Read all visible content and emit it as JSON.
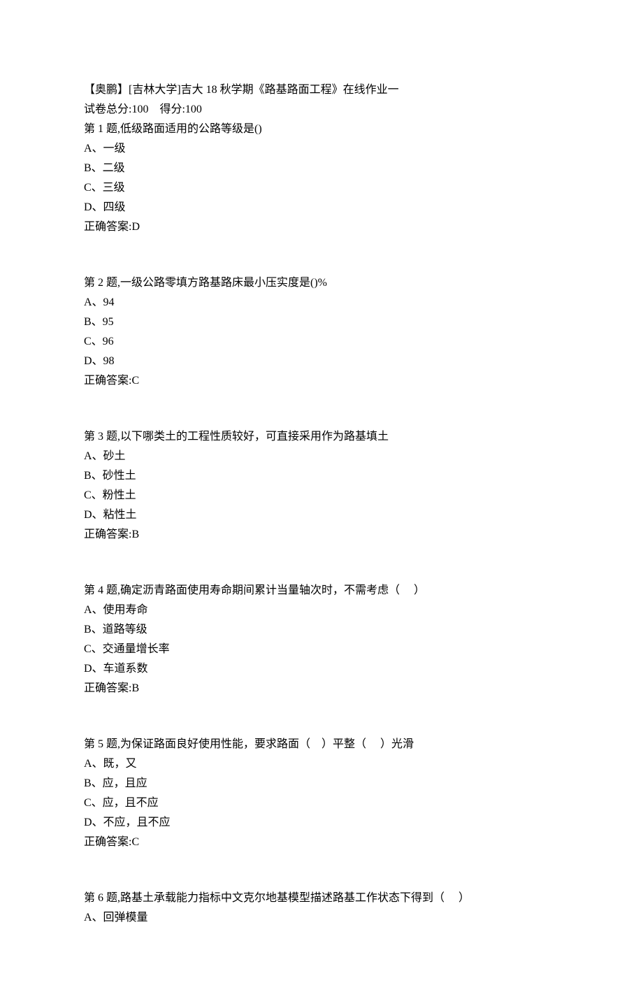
{
  "header": {
    "title": "【奥鹏】[吉林大学]吉大 18 秋学期《路基路面工程》在线作业一",
    "scoreline": "试卷总分:100    得分:100"
  },
  "questions": [
    {
      "stem": "第 1 题,低级路面适用的公路等级是()",
      "options": [
        "A、一级",
        "B、二级",
        "C、三级",
        "D、四级"
      ],
      "answer": "正确答案:D"
    },
    {
      "stem": "第 2 题,一级公路零填方路基路床最小压实度是()%",
      "options": [
        "A、94",
        "B、95",
        "C、96",
        "D、98"
      ],
      "answer": "正确答案:C"
    },
    {
      "stem": "第 3 题,以下哪类土的工程性质较好，可直接采用作为路基填土",
      "options": [
        "A、砂土",
        "B、砂性土",
        "C、粉性土",
        "D、粘性土"
      ],
      "answer": "正确答案:B"
    },
    {
      "stem": "第 4 题,确定沥青路面使用寿命期间累计当量轴次时，不需考虑（     ）",
      "options": [
        "A、使用寿命",
        "B、道路等级",
        "C、交通量增长率",
        "D、车道系数"
      ],
      "answer": "正确答案:B"
    },
    {
      "stem": "第 5 题,为保证路面良好使用性能，要求路面（    ）平整（     ）光滑",
      "options": [
        "A、既，又",
        "B、应，且应",
        "C、应，且不应",
        "D、不应，且不应"
      ],
      "answer": "正确答案:C"
    },
    {
      "stem": "第 6 题,路基土承载能力指标中文克尔地基模型描述路基工作状态下得到（     ）",
      "options": [
        "A、回弹模量"
      ],
      "answer": ""
    }
  ]
}
